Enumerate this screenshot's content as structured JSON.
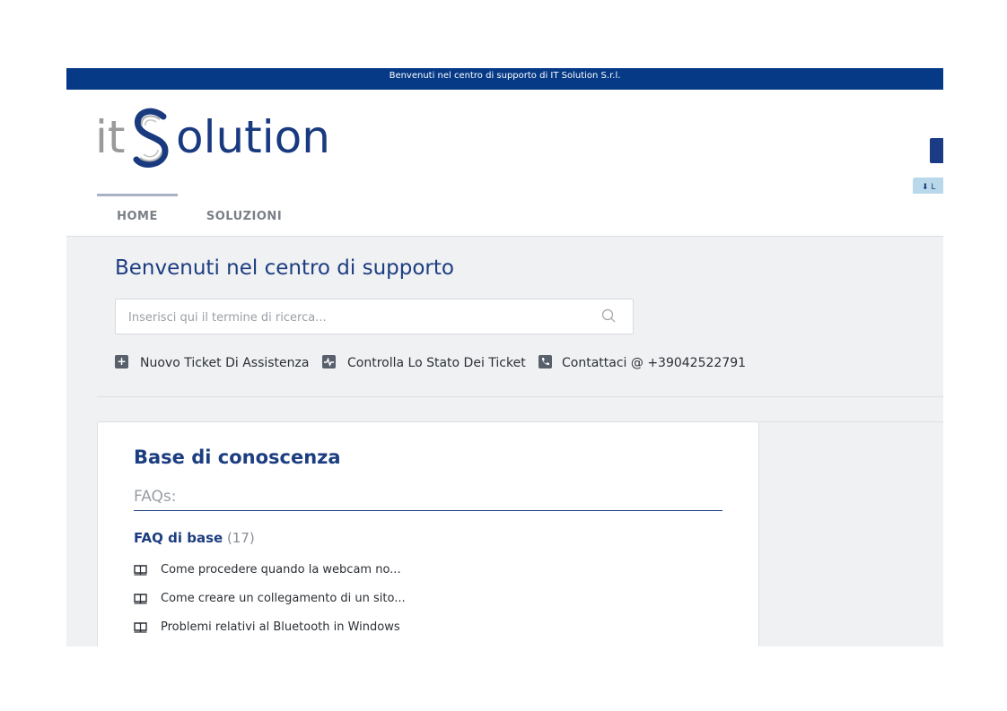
{
  "topbar": {
    "text": "Benvenuti nel centro di supporto di IT Solution S.r.l."
  },
  "logo": {
    "prefix": "it",
    "suffix": "olution",
    "letter": "S"
  },
  "header": {
    "download_label": "L"
  },
  "nav": {
    "items": [
      {
        "label": "HOME",
        "active": true
      },
      {
        "label": "SOLUZIONI",
        "active": false
      }
    ]
  },
  "hero": {
    "title": "Benvenuti nel centro di supporto",
    "search_placeholder": "Inserisci qui il termine di ricerca...",
    "quicklinks": [
      {
        "label": "Nuovo Ticket Di Assistenza",
        "icon": "plus-icon"
      },
      {
        "label": "Controlla Lo Stato Dei Ticket",
        "icon": "pulse-icon"
      },
      {
        "label": "Contattaci @ +39042522791",
        "icon": "phone-icon"
      }
    ]
  },
  "kb": {
    "title": "Base di conoscenza",
    "subtitle": "FAQs:",
    "category": {
      "name": "FAQ di base",
      "count": "(17)"
    },
    "articles": [
      "Come procedere quando la webcam no...",
      "Come creare un collegamento di un sito...",
      "Problemi relativi al Bluetooth in Windows"
    ]
  },
  "colors": {
    "brand_blue": "#063a86",
    "title_blue": "#1c3d80",
    "hero_bg": "#f0f1f3"
  }
}
